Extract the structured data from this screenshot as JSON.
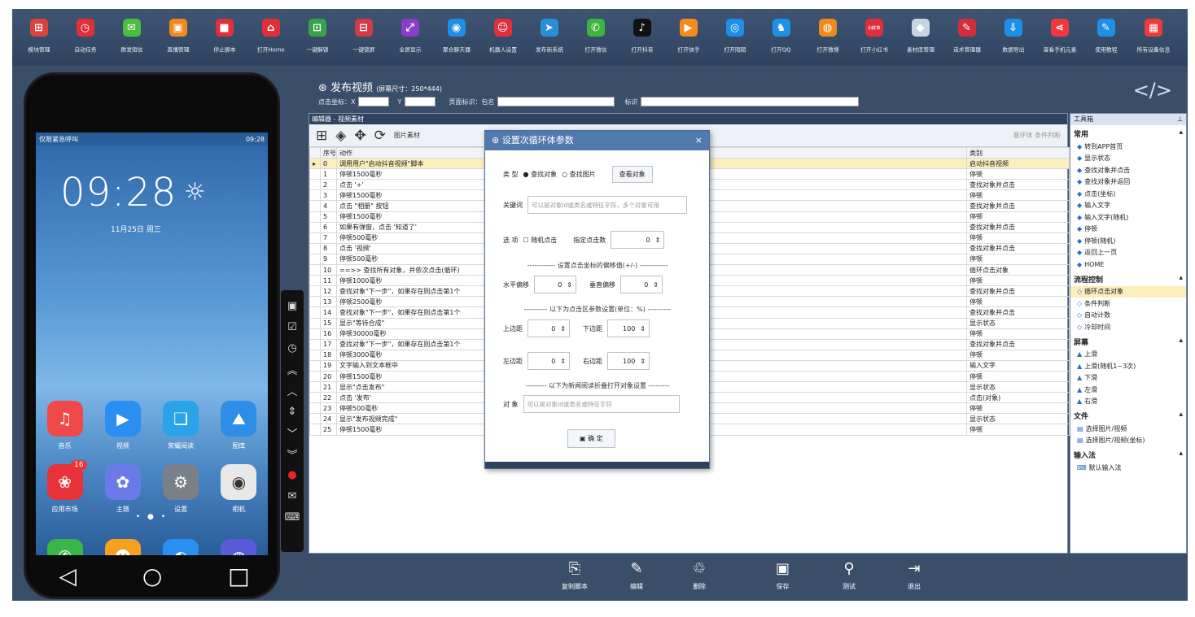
{
  "toolbar": [
    {
      "label": "模块管理",
      "icon": "module-icon",
      "color": "#d9433a"
    },
    {
      "label": "自动任务",
      "icon": "clock-icon",
      "color": "#e02f3a"
    },
    {
      "label": "群发短信",
      "icon": "message-icon",
      "color": "#4bbf3c"
    },
    {
      "label": "直播管理",
      "icon": "tv-icon",
      "color": "#f08a1e"
    },
    {
      "label": "停止脚本",
      "icon": "stop-icon",
      "color": "#e02f3a"
    },
    {
      "label": "打开Home",
      "icon": "home-icon",
      "color": "#e02f3a"
    },
    {
      "label": "一键解锁",
      "icon": "unlock-icon",
      "color": "#3aa24a"
    },
    {
      "label": "一键锁屏",
      "icon": "lock-icon",
      "color": "#d23a4a"
    },
    {
      "label": "全屏显示",
      "icon": "fullscreen-icon",
      "color": "#8a3ec8"
    },
    {
      "label": "聚合聊天器",
      "icon": "chat-aggregator-icon",
      "color": "#1e8ee6"
    },
    {
      "label": "机器人设置",
      "icon": "robot-icon",
      "color": "#e02f3a"
    },
    {
      "label": "发布新系统",
      "icon": "send-icon",
      "color": "#2a8fd8"
    },
    {
      "label": "打开微信",
      "icon": "wechat-icon",
      "color": "#3db53c"
    },
    {
      "label": "打开抖音",
      "icon": "tiktok-icon",
      "color": "#111111"
    },
    {
      "label": "打开快手",
      "icon": "kuaishou-icon",
      "color": "#f58a1f"
    },
    {
      "label": "打开陌陌",
      "icon": "momo-icon",
      "color": "#1e8ee6"
    },
    {
      "label": "打开QQ",
      "icon": "qq-icon",
      "color": "#1e90e6"
    },
    {
      "label": "打开微博",
      "icon": "weibo-icon",
      "color": "#f08a1e"
    },
    {
      "label": "打开小红书",
      "icon": "xiaohongshu-icon",
      "color": "#e02f3a",
      "text": "小红书"
    },
    {
      "label": "素材库管理",
      "icon": "material-icon",
      "color": "#c8d4e2"
    },
    {
      "label": "话术管理器",
      "icon": "script-talk-icon",
      "color": "#d02f3a"
    },
    {
      "label": "数据导出",
      "icon": "export-icon",
      "color": "#1e8ee6"
    },
    {
      "label": "查看手机元素",
      "icon": "share-icon",
      "color": "#f03a3a"
    },
    {
      "label": "使用教程",
      "icon": "tutorial-icon",
      "color": "#1e8ee6"
    },
    {
      "label": "所有设备信息",
      "icon": "devices-icon",
      "color": "#f03a3a"
    }
  ],
  "phone": {
    "status_left": "仅限紧急呼叫",
    "status_right": "09:28",
    "time": "09:28",
    "date": "11月25日 周三",
    "row1": [
      {
        "label": "音乐",
        "icon": "music-icon",
        "color": "#f04848"
      },
      {
        "label": "视频",
        "icon": "video-icon",
        "color": "#2a8ff0"
      },
      {
        "label": "荣耀阅读",
        "icon": "book-icon",
        "color": "#2aa3e8"
      },
      {
        "label": "图库",
        "icon": "gallery-icon",
        "color": "#2e8ee6"
      }
    ],
    "row2": [
      {
        "label": "应用市场",
        "icon": "huawei-icon",
        "color": "#e8323a",
        "badge": "16"
      },
      {
        "label": "主题",
        "icon": "theme-icon",
        "color": "#6a7ae8"
      },
      {
        "label": "设置",
        "icon": "settings-icon",
        "color": "#7a7f88"
      },
      {
        "label": "相机",
        "icon": "camera-icon",
        "color": "#e8e8e8"
      }
    ],
    "dock": [
      {
        "icon": "phone-icon",
        "color": "#3ab54a"
      },
      {
        "icon": "contacts-icon",
        "color": "#f5a020"
      },
      {
        "icon": "sms-icon",
        "color": "#2a8ff0"
      },
      {
        "icon": "browser-icon",
        "color": "#5a5ad8"
      }
    ]
  },
  "header": {
    "title": "发布视频",
    "screen_size": "(屏幕尺寸：250*444)",
    "click_coord_label": "点击坐标：X",
    "y_label": "Y",
    "page_id_label": "页面标识：包名",
    "flag_label": "标识"
  },
  "editor": {
    "title": "编辑器 - 视频素材",
    "tool_img": "图片素材",
    "right_tools": "循环体  条件判断",
    "columns": [
      "序号",
      "动作",
      "类别"
    ],
    "rows": [
      [
        "0",
        "调用用户\"启动抖音视频\"脚本",
        "启动抖音视频"
      ],
      [
        "1",
        "停顿1500毫秒",
        "停顿"
      ],
      [
        "2",
        "点击 '+'",
        "查找对象并点击"
      ],
      [
        "3",
        "停顿1500毫秒",
        "停顿"
      ],
      [
        "4",
        "点击 \"相册\" 按钮",
        "查找对象并点击"
      ],
      [
        "5",
        "停顿1500毫秒",
        "停顿"
      ],
      [
        "6",
        "如果有弹窗，点击 '知道了'",
        "查找对象并点击"
      ],
      [
        "7",
        "停顿500毫秒",
        "停顿"
      ],
      [
        "8",
        "点击 '视频'",
        "查找对象并点击"
      ],
      [
        "9",
        "停顿500毫秒",
        "停顿"
      ],
      [
        "10",
        "==>> 查找所有对象，并依次点击(循环)",
        "循环点击对象"
      ],
      [
        "11",
        "停顿1000毫秒",
        "停顿"
      ],
      [
        "12",
        "查找对象\"下一步\"，如果存在则点击第1个",
        "查找对象并点击"
      ],
      [
        "13",
        "停顿2500毫秒",
        "停顿"
      ],
      [
        "14",
        "查找对象\"下一步\"，如果存在则点击第1个",
        "查找对象并点击"
      ],
      [
        "15",
        "显示\"等待合成\"",
        "显示状态"
      ],
      [
        "16",
        "停顿30000毫秒",
        "停顿"
      ],
      [
        "17",
        "查找对象\"下一步\"，如果存在则点击第1个",
        "查找对象并点击"
      ],
      [
        "18",
        "停顿3000毫秒",
        "停顿"
      ],
      [
        "19",
        "文字输入到文本框中",
        "输入文字"
      ],
      [
        "20",
        "停顿1500毫秒",
        "停顿"
      ],
      [
        "21",
        "显示\"点击发布\"",
        "显示状态"
      ],
      [
        "22",
        "点击 '发布'",
        "点击(对象)"
      ],
      [
        "23",
        "停顿500毫秒",
        "停顿"
      ],
      [
        "24",
        "显示\"发布视频完成\"",
        "显示状态"
      ],
      [
        "25",
        "停顿1500毫秒",
        "停顿"
      ]
    ]
  },
  "dialog": {
    "title": "设置次循环体参数",
    "type_label": "类  型",
    "opt_find_object": "查找对象",
    "opt_find_image": "查找图片",
    "view_object": "查看对象",
    "keyword_label": "关键词",
    "keyword_placeholder": "可以是对象id或类名或特征字符，多个对象可用",
    "options_label": "选  项",
    "random_click": "随机点击",
    "click_count_label": "指定点击数",
    "click_count": "0",
    "offset_sep": "------------ 设置点击坐标的偏移值(+/-) ------------",
    "h_offset_label": "水平偏移",
    "h_offset": "0",
    "v_offset_label": "垂直偏移",
    "v_offset": "0",
    "area_sep": "---------- 以下为点击区参数设置(单位：%) ----------",
    "top_label": "上边距",
    "top": "0",
    "bottom_label": "下边距",
    "bottom": "100",
    "left_label": "左边距",
    "left": "0",
    "right_label": "右边距",
    "right": "100",
    "fold_sep": "--------- 以下为新闻阅读折叠打开对象设置 ---------",
    "object_label": "对  象",
    "object_placeholder": "可以是对象id或类名或特征字符",
    "ok": "确 定"
  },
  "toolbox": {
    "title": "工具箱",
    "sections": [
      {
        "name": "常用",
        "items": [
          "转到APP首页",
          "显示状态",
          "查找对象并点击",
          "查找对象并返回",
          "点击(坐标)",
          "输入文字",
          "输入文字(随机)",
          "停顿",
          "停顿(随机)",
          "返回上一页",
          "HOME"
        ]
      },
      {
        "name": "流程控制",
        "items": [
          "循环点击对象",
          "条件判断",
          "自动计数",
          "冷却时间"
        ]
      },
      {
        "name": "屏幕",
        "items": [
          "上滑",
          "上滑(随机1~3次)",
          "下滑",
          "左滑",
          "右滑"
        ]
      },
      {
        "name": "文件",
        "items": [
          "选择图片/视频",
          "选择图片/视频(坐标)"
        ]
      },
      {
        "name": "输入法",
        "items": [
          "默认输入法"
        ]
      }
    ]
  },
  "actions": [
    {
      "label": "复制脚本",
      "icon": "copy-icon"
    },
    {
      "label": "编辑",
      "icon": "edit-icon"
    },
    {
      "label": "删除",
      "icon": "delete-icon"
    },
    {
      "label": "保存",
      "icon": "save-icon"
    },
    {
      "label": "测试",
      "icon": "test-icon"
    },
    {
      "label": "退出",
      "icon": "exit-icon"
    }
  ]
}
